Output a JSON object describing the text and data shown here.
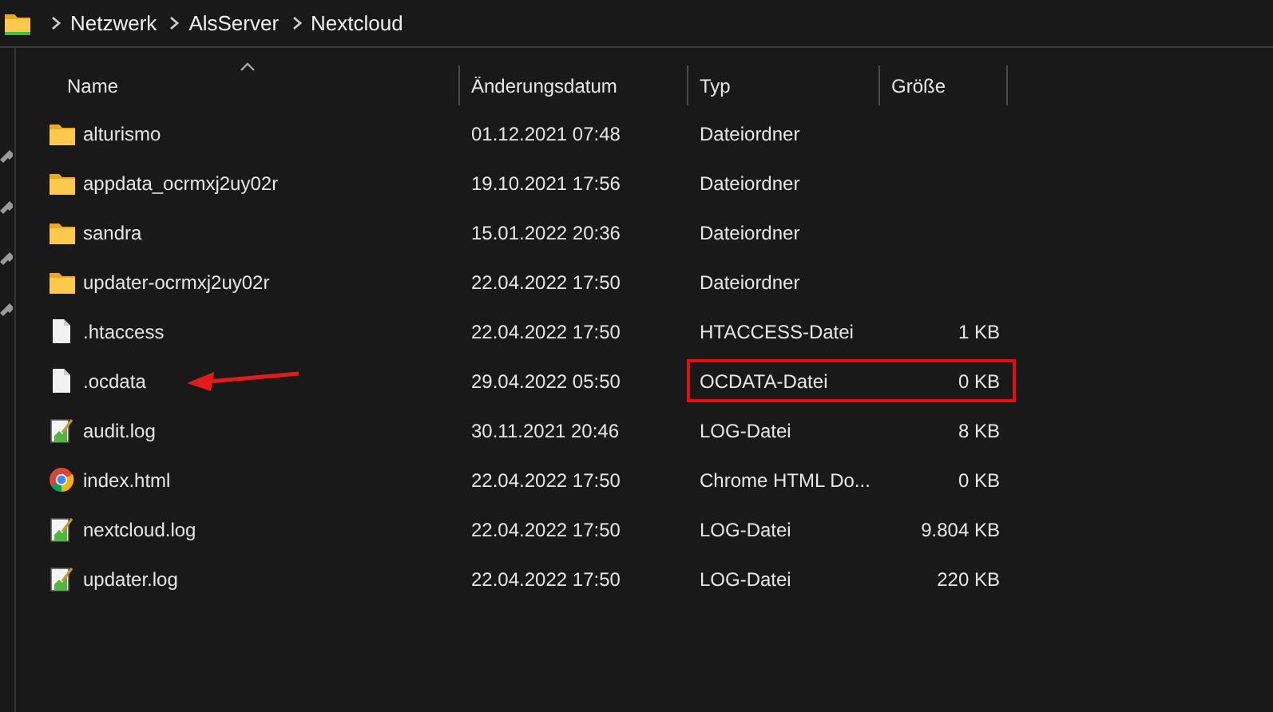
{
  "breadcrumb": [
    "Netzwerk",
    "AlsServer",
    "Nextcloud"
  ],
  "columns": [
    {
      "label": "Name",
      "sorted": true
    },
    {
      "label": "Änderungsdatum",
      "sorted": false
    },
    {
      "label": "Typ",
      "sorted": false
    },
    {
      "label": "Größe",
      "sorted": false
    }
  ],
  "rows": [
    {
      "kind": "folder",
      "name": "alturismo",
      "date": "01.12.2021 07:48",
      "type": "Dateiordner",
      "size": "",
      "highlighted": false,
      "arrow": false
    },
    {
      "kind": "folder",
      "name": "appdata_ocrmxj2uy02r",
      "date": "19.10.2021 17:56",
      "type": "Dateiordner",
      "size": "",
      "highlighted": false,
      "arrow": false
    },
    {
      "kind": "folder",
      "name": "sandra",
      "date": "15.01.2022 20:36",
      "type": "Dateiordner",
      "size": "",
      "highlighted": false,
      "arrow": false
    },
    {
      "kind": "folder",
      "name": "updater-ocrmxj2uy02r",
      "date": "22.04.2022 17:50",
      "type": "Dateiordner",
      "size": "",
      "highlighted": false,
      "arrow": false
    },
    {
      "kind": "file",
      "name": ".htaccess",
      "date": "22.04.2022 17:50",
      "type": "HTACCESS-Datei",
      "size": "1 KB",
      "highlighted": false,
      "arrow": false
    },
    {
      "kind": "file",
      "name": ".ocdata",
      "date": "29.04.2022 05:50",
      "type": "OCDATA-Datei",
      "size": "0 KB",
      "highlighted": true,
      "arrow": true
    },
    {
      "kind": "log",
      "name": "audit.log",
      "date": "30.11.2021 20:46",
      "type": "LOG-Datei",
      "size": "8 KB",
      "highlighted": false,
      "arrow": false
    },
    {
      "kind": "chrome",
      "name": "index.html",
      "date": "22.04.2022 17:50",
      "type": "Chrome HTML Do...",
      "size": "0 KB",
      "highlighted": false,
      "arrow": false
    },
    {
      "kind": "log",
      "name": "nextcloud.log",
      "date": "22.04.2022 17:50",
      "type": "LOG-Datei",
      "size": "9.804 KB",
      "highlighted": false,
      "arrow": false
    },
    {
      "kind": "log",
      "name": "updater.log",
      "date": "22.04.2022 17:50",
      "type": "LOG-Datei",
      "size": "220 KB",
      "highlighted": false,
      "arrow": false
    }
  ]
}
